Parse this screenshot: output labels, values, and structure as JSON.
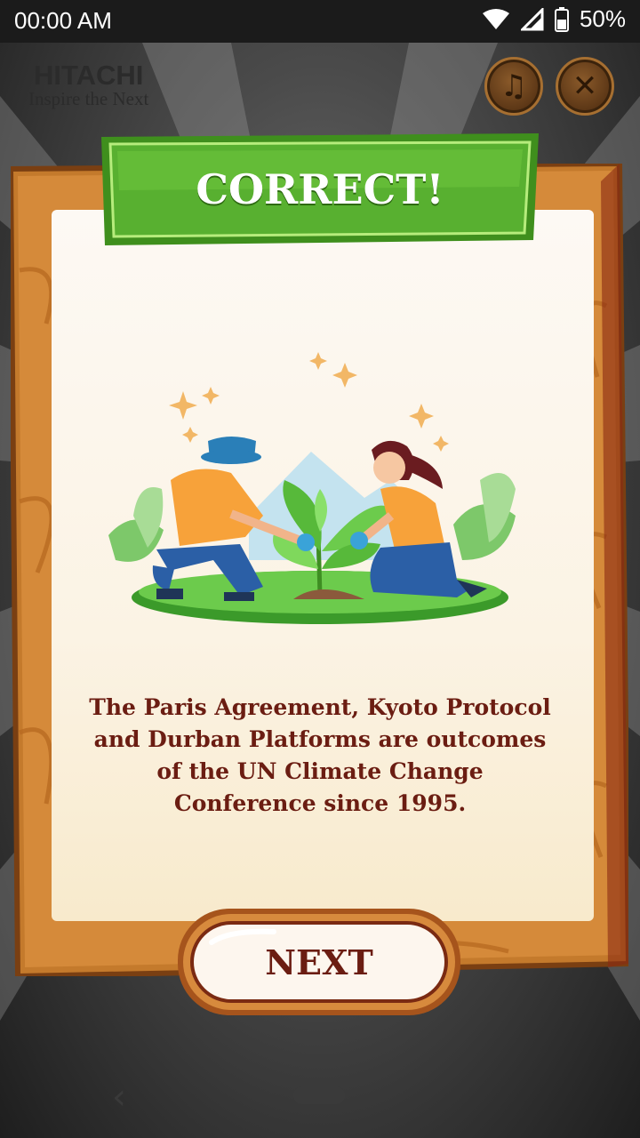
{
  "status_bar": {
    "time": "00:00 AM",
    "battery": "50%"
  },
  "logo": {
    "brand": "HITACHI",
    "tagline": "Inspire the Next"
  },
  "controls": {
    "music_icon": "music-note-icon",
    "close_icon": "close-icon"
  },
  "dialog": {
    "title": "CORRECT!",
    "message": "The Paris Agreement, Kyoto Protocol and Durban Platforms are outcomes of the UN Climate Change Conference since 1995.",
    "next_label": "NEXT"
  },
  "colors": {
    "banner_green": "#4caf2a",
    "wood": "#c47a2c",
    "text_maroon": "#6b1d12"
  }
}
